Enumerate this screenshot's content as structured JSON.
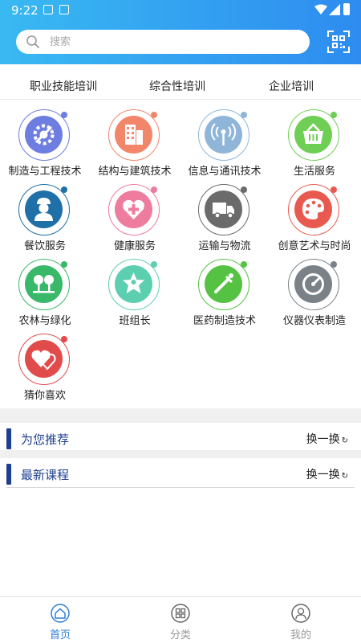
{
  "status_bar": {
    "time": "9:22"
  },
  "search": {
    "placeholder": "搜索"
  },
  "category_tabs": [
    "职业技能培训",
    "综合性培训",
    "企业培训"
  ],
  "grid_items": [
    {
      "label": "制造与工程技术",
      "icon": "gear-wrench-icon",
      "color": "#6e7de0"
    },
    {
      "label": "结构与建筑技术",
      "icon": "buildings-icon",
      "color": "#f2866b"
    },
    {
      "label": "信息与通讯技术",
      "icon": "signal-tower-icon",
      "color": "#8fb6d8"
    },
    {
      "label": "生活服务",
      "icon": "basket-icon",
      "color": "#6fcf54"
    },
    {
      "label": "餐饮服务",
      "icon": "chef-icon",
      "color": "#1f6fa8"
    },
    {
      "label": "健康服务",
      "icon": "heart-plus-icon",
      "color": "#ee7c9e"
    },
    {
      "label": "运输与物流",
      "icon": "truck-icon",
      "color": "#6b6b6b"
    },
    {
      "label": "创意艺术与时尚",
      "icon": "palette-icon",
      "color": "#e85a4f"
    },
    {
      "label": "农林与绿化",
      "icon": "trees-icon",
      "color": "#39b86a"
    },
    {
      "label": "班组长",
      "icon": "star-person-icon",
      "color": "#5ccfb0"
    },
    {
      "label": "医药制造技术",
      "icon": "dropper-icon",
      "color": "#56c243"
    },
    {
      "label": "仪器仪表制造",
      "icon": "gauge-icon",
      "color": "#7b8287"
    },
    {
      "label": "猜你喜欢",
      "icon": "hearts-icon",
      "color": "#e24b4b"
    }
  ],
  "sections": [
    {
      "title": "为您推荐",
      "refresh_label": "换一换"
    },
    {
      "title": "最新课程",
      "refresh_label": "换一换"
    }
  ],
  "bottom_nav": [
    {
      "label": "首页",
      "active": true
    },
    {
      "label": "分类",
      "active": false
    },
    {
      "label": "我的",
      "active": false
    }
  ],
  "colors": {
    "header_start": "#39b9f2",
    "header_end": "#2e8cf0",
    "accent": "#1c3f8f",
    "nav_active": "#2e7fd9",
    "nav_inactive": "#9a9a9a"
  }
}
